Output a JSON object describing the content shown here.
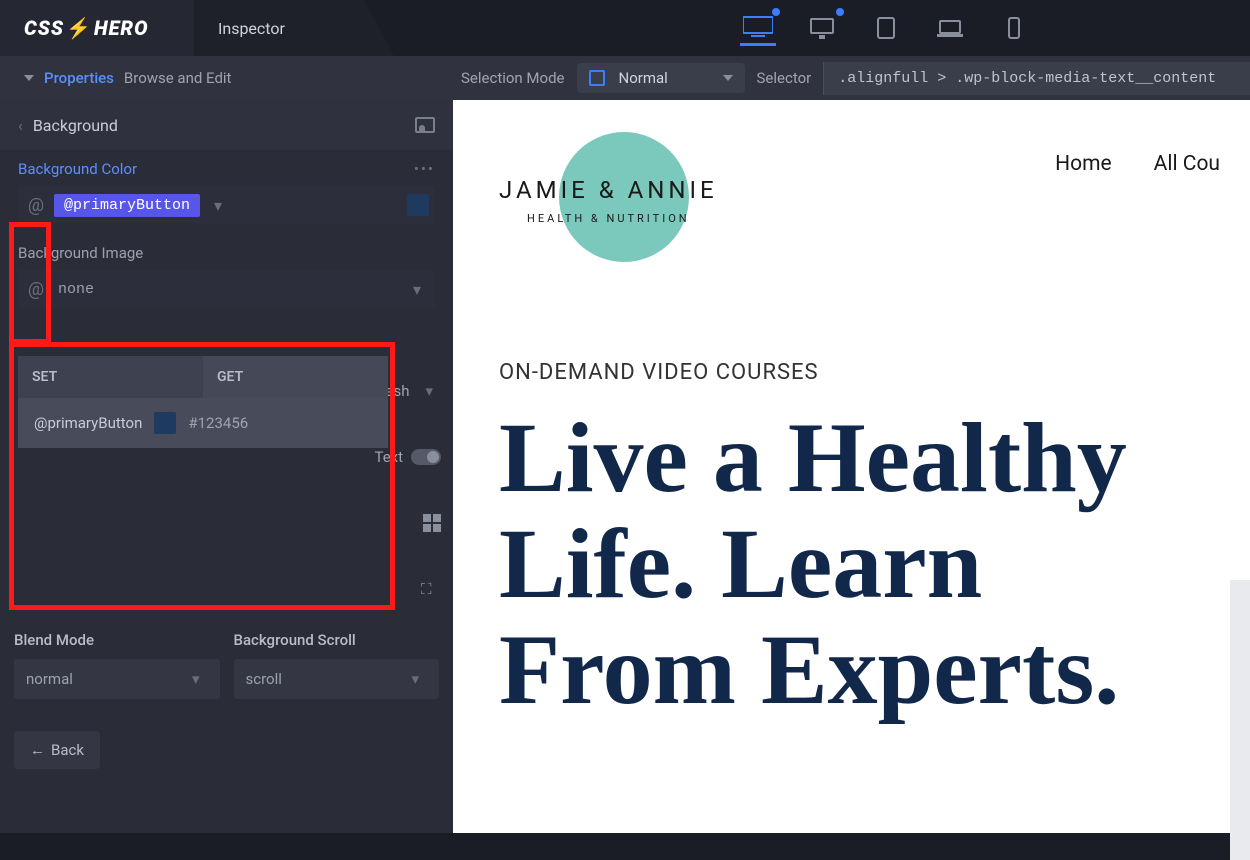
{
  "topbar": {
    "logo": "CSS",
    "logo_suffix": "HERO",
    "inspector_tab": "Inspector"
  },
  "subbar": {
    "properties_link": "Properties",
    "browse_edit": "Browse and Edit",
    "selection_mode_label": "Selection Mode",
    "selection_mode_value": "Normal",
    "selector_label": "Selector",
    "selector_value": ".alignfull > .wp-block-media-text__content"
  },
  "panel": {
    "section_title": "Background",
    "bg_color_label": "Background Color",
    "bg_color_value": "@primaryButton",
    "bg_image_label": "Background Image",
    "bg_image_value": "none",
    "mesh_label": "esh",
    "text_label": "Text"
  },
  "popup": {
    "tab_set": "SET",
    "tab_get": "GET",
    "item_name": "@primaryButton",
    "item_value": "#123456"
  },
  "bottom": {
    "blend_mode_label": "Blend Mode",
    "blend_mode_value": "normal",
    "bg_scroll_label": "Background Scroll",
    "bg_scroll_value": "scroll",
    "back_btn": "Back"
  },
  "preview": {
    "brand_name": "JAMIE & ANNIE",
    "brand_sub": "HEALTH & NUTRITION",
    "nav_home": "Home",
    "nav_courses": "All Cou",
    "eyebrow": "ON-DEMAND VIDEO COURSES",
    "headline": "Live a Healthy Life. Learn From Experts."
  }
}
